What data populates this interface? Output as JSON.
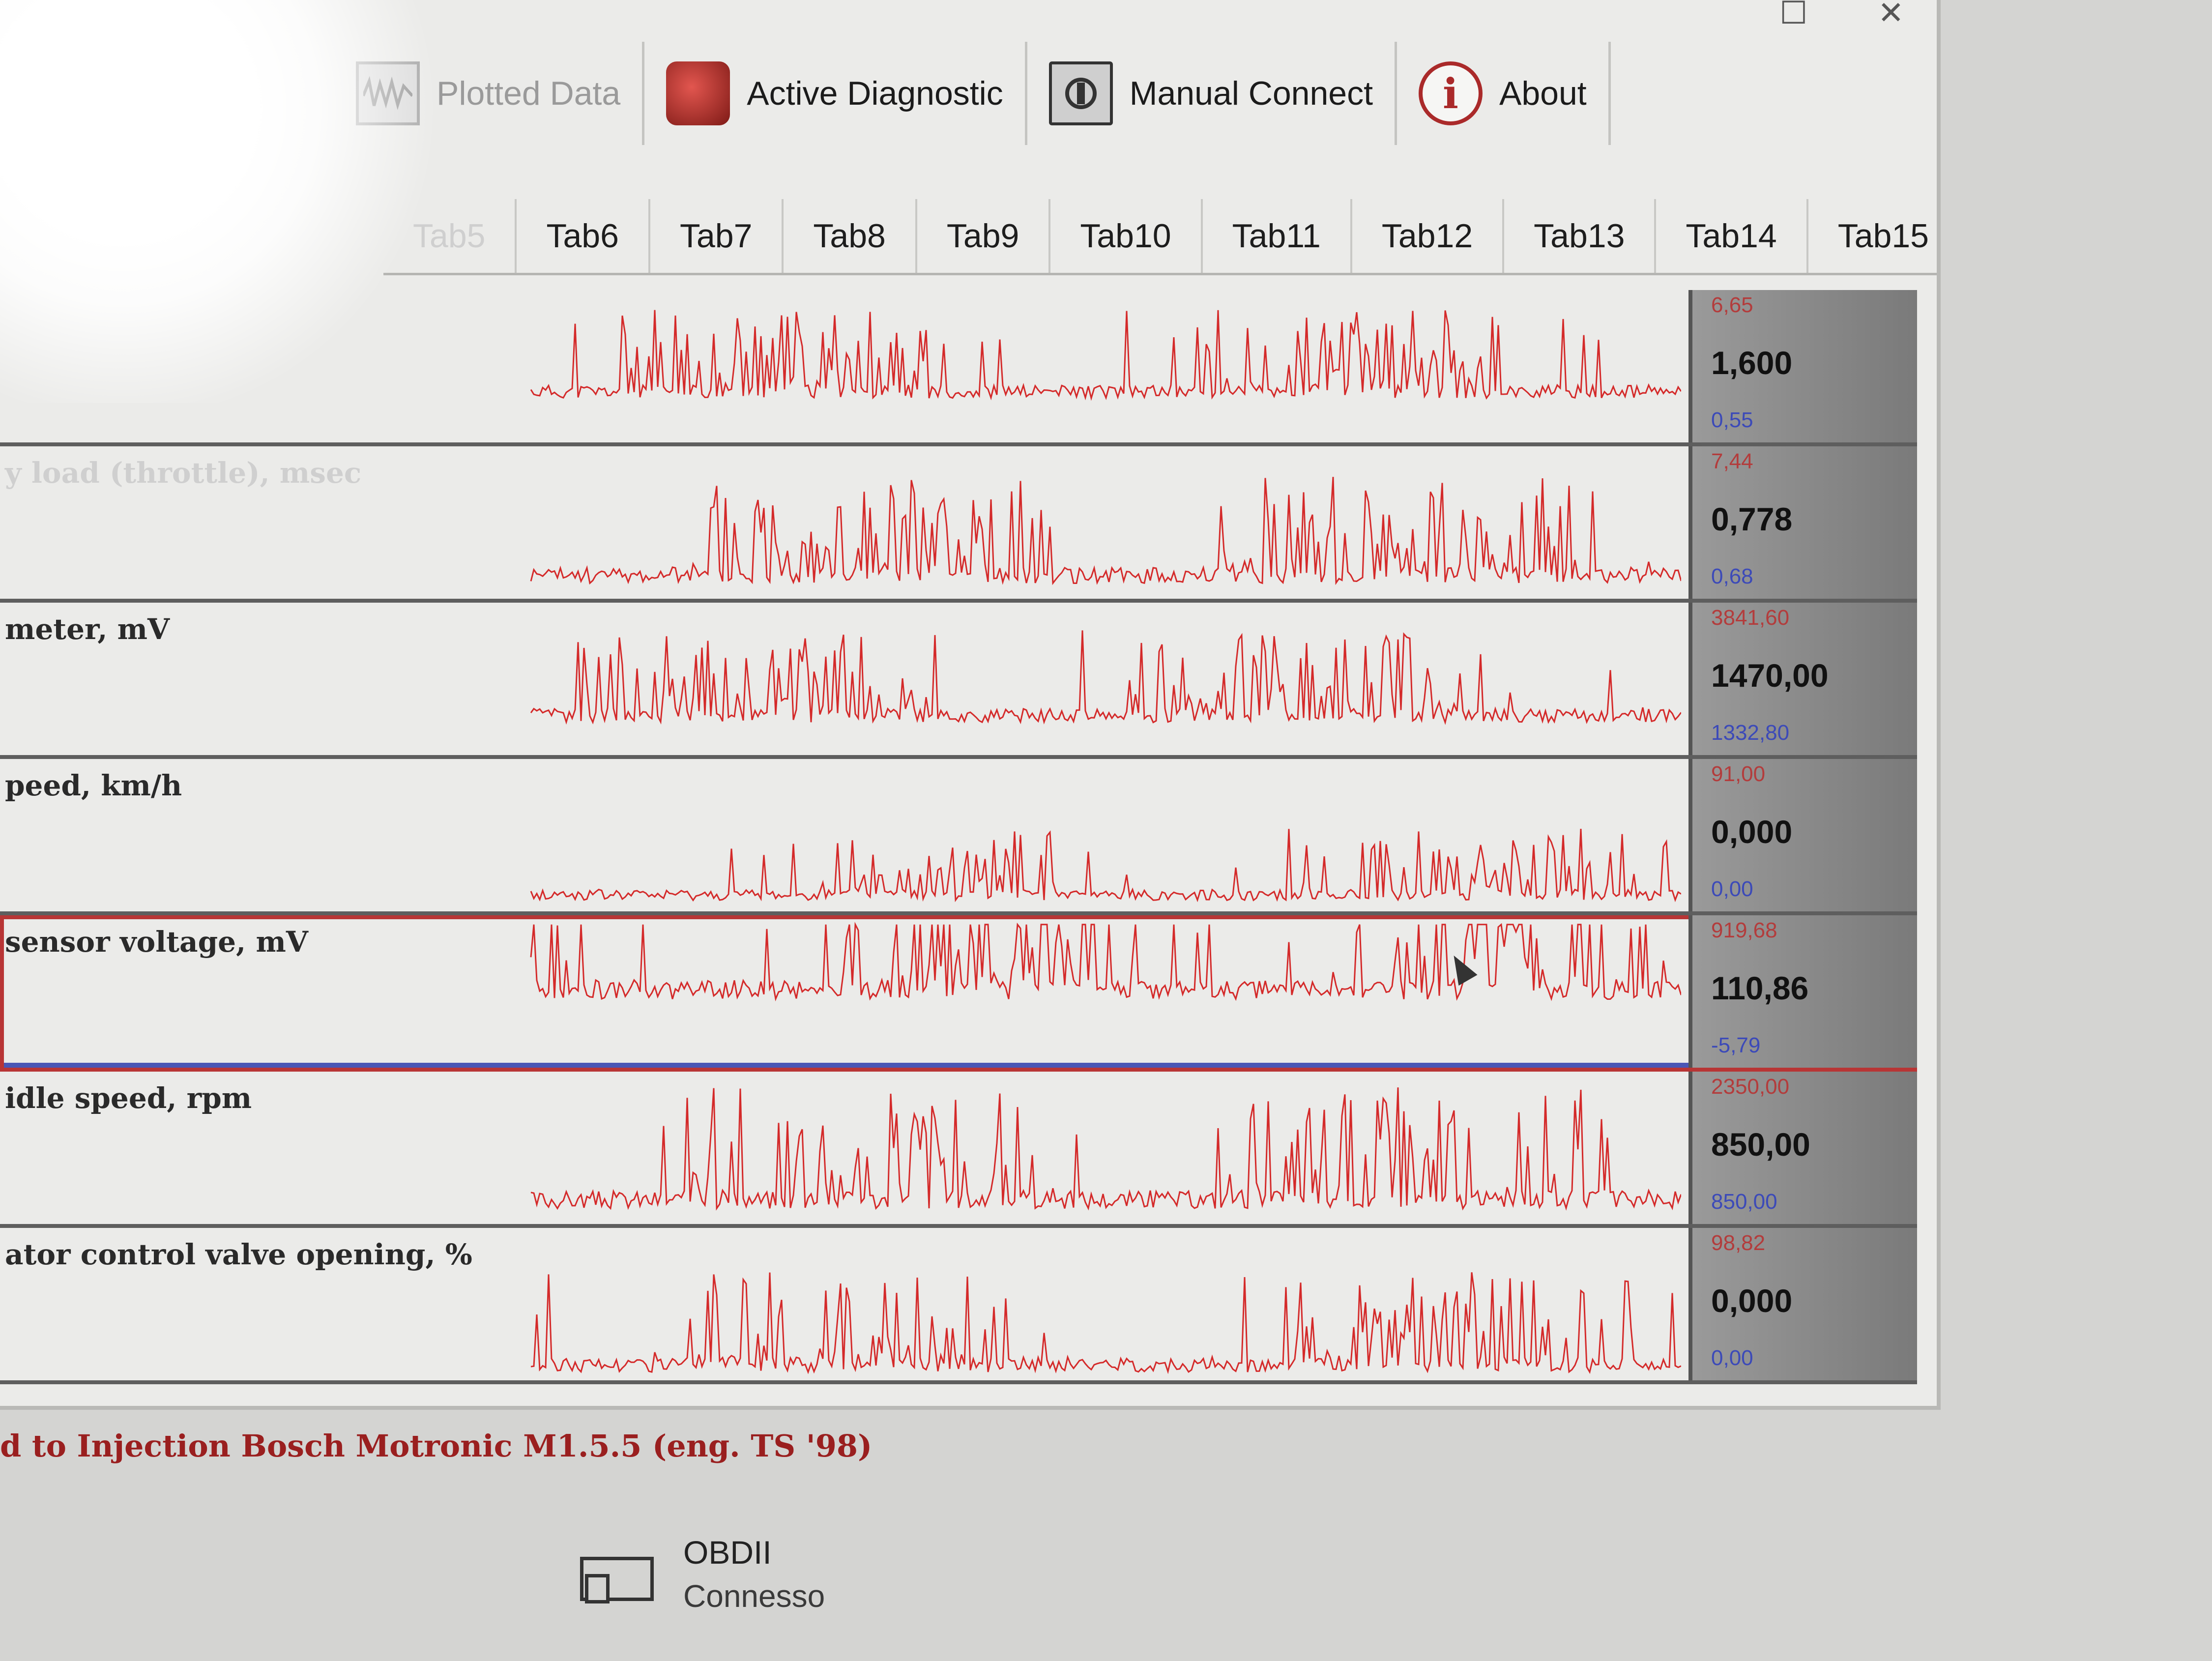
{
  "toolbar": [
    {
      "label": "Plotted Data",
      "icon": "plotted-data-icon",
      "dim": true
    },
    {
      "label": "Active Diagnostic",
      "icon": "engine-icon",
      "dim": false
    },
    {
      "label": "Manual Connect",
      "icon": "manual-connect-icon",
      "dim": false
    },
    {
      "label": "About",
      "icon": "info-icon",
      "dim": false
    }
  ],
  "window": {
    "maximize_glyph": "☐",
    "close_glyph": "✕"
  },
  "tabs": [
    "Tab5",
    "Tab6",
    "Tab7",
    "Tab8",
    "Tab9",
    "Tab10",
    "Tab11",
    "Tab12",
    "Tab13",
    "Tab14",
    "Tab15"
  ],
  "tab_arrows": [
    "‹",
    "›"
  ],
  "rows": [
    {
      "label": "",
      "max": "6,65",
      "current": "1,600",
      "min": "0,55",
      "selected": false,
      "seed": 11,
      "base": 0.72,
      "amp": 0.62
    },
    {
      "label": "y load (throttle), msec",
      "max": "7,44",
      "current": "0,778",
      "min": "0,68",
      "selected": false,
      "seed": 23,
      "base": 0.92,
      "amp": 0.75
    },
    {
      "label": "meter, mV",
      "max": "3841,60",
      "current": "1470,00",
      "min": "1332,80",
      "selected": false,
      "seed": 37,
      "base": 0.8,
      "amp": 0.65
    },
    {
      "label": "peed, km/h",
      "max": "91,00",
      "current": "0,000",
      "min": "0,00",
      "selected": false,
      "seed": 41,
      "base": 0.95,
      "amp": 0.5
    },
    {
      "label": "sensor voltage, mV",
      "max": "919,68",
      "current": "110,86",
      "min": "-5,79",
      "selected": true,
      "seed": 53,
      "base": 0.55,
      "amp": 0.9
    },
    {
      "label": "idle speed, rpm",
      "max": "2350,00",
      "current": "850,00",
      "min": "850,00",
      "selected": false,
      "seed": 67,
      "base": 0.92,
      "amp": 0.85
    },
    {
      "label": "ator control valve opening, %",
      "max": "98,82",
      "current": "0,000",
      "min": "0,00",
      "selected": false,
      "seed": 79,
      "base": 0.97,
      "amp": 0.7
    }
  ],
  "status": "d to Injection Bosch Motronic M1.5.5 (eng. TS '98)",
  "obd": {
    "name": "OBDII",
    "state": "Connesso"
  },
  "colors": {
    "trace": "#d42a2a",
    "max_text": "#b33c3c",
    "min_text": "#3c4ab8",
    "status_text": "#9a1f1f"
  }
}
